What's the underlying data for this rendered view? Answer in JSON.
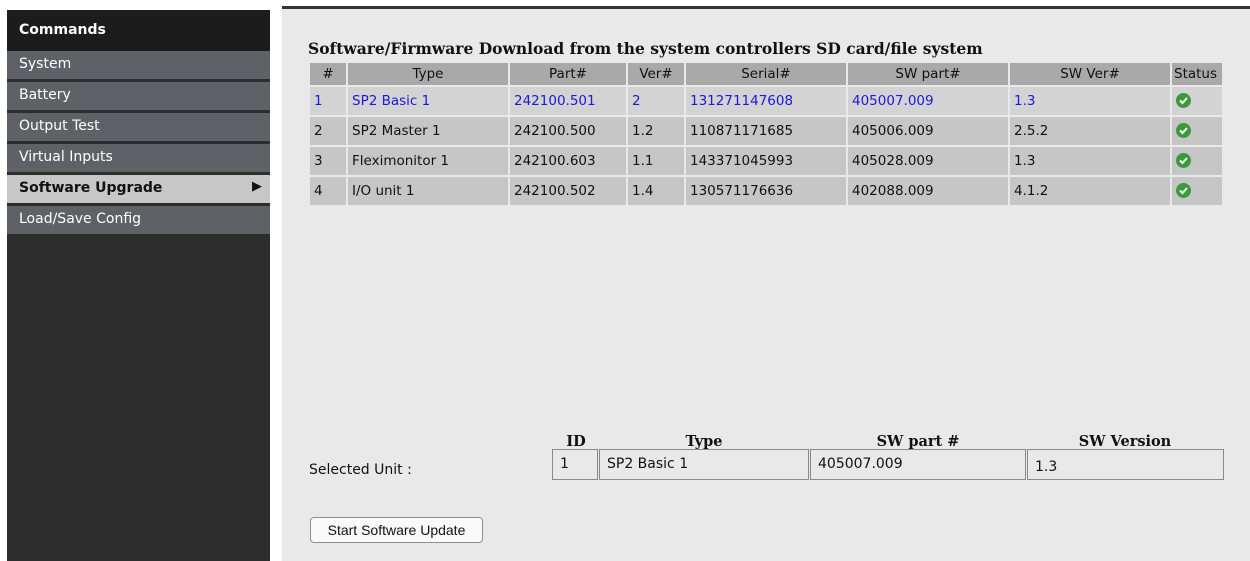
{
  "sidebar": {
    "header": "Commands",
    "items": [
      {
        "label": "System",
        "active": false
      },
      {
        "label": "Battery",
        "active": false
      },
      {
        "label": "Output Test",
        "active": false
      },
      {
        "label": "Virtual Inputs",
        "active": false
      },
      {
        "label": "Software Upgrade",
        "active": true
      },
      {
        "label": "Load/Save Config",
        "active": false
      }
    ],
    "active_arrow": "▶"
  },
  "main": {
    "title": "Software/Firmware Download from the system controllers SD card/file system",
    "table": {
      "columns": [
        "#",
        "Type",
        "Part#",
        "Ver#",
        "Serial#",
        "SW part#",
        "SW Ver#",
        "Status"
      ],
      "rows": [
        {
          "num": "1",
          "type": "SP2 Basic 1",
          "part": "242100.501",
          "ver": "2",
          "serial": "131271147608",
          "sw_part": "405007.009",
          "sw_ver": "1.3",
          "status": "ok",
          "selected": true
        },
        {
          "num": "2",
          "type": "SP2 Master 1",
          "part": "242100.500",
          "ver": "1.2",
          "serial": "110871171685",
          "sw_part": "405006.009",
          "sw_ver": "2.5.2",
          "status": "ok",
          "selected": false
        },
        {
          "num": "3",
          "type": "Fleximonitor 1",
          "part": "242100.603",
          "ver": "1.1",
          "serial": "143371045993",
          "sw_part": "405028.009",
          "sw_ver": "1.3",
          "status": "ok",
          "selected": false
        },
        {
          "num": "4",
          "type": "I/O unit 1",
          "part": "242100.502",
          "ver": "1.4",
          "serial": "130571176636",
          "sw_part": "402088.009",
          "sw_ver": "4.1.2",
          "status": "ok",
          "selected": false
        }
      ]
    },
    "selected_unit": {
      "label": "Selected Unit :",
      "headers": {
        "id": "ID",
        "type": "Type",
        "sw_part": "SW part #",
        "sw_version": "SW Version"
      },
      "values": {
        "id": "1",
        "type": "SP2 Basic 1",
        "sw_part": "405007.009",
        "sw_version": "1.3"
      }
    },
    "start_button": "Start Software Update"
  },
  "colors": {
    "selected_text": "#1a1adb",
    "status_ok": "#3a9a3a",
    "sidebar_bg": "#2d2d2d",
    "sidebar_item": "#5e6266"
  },
  "icons": {
    "status_ok": "check-circle-icon"
  }
}
